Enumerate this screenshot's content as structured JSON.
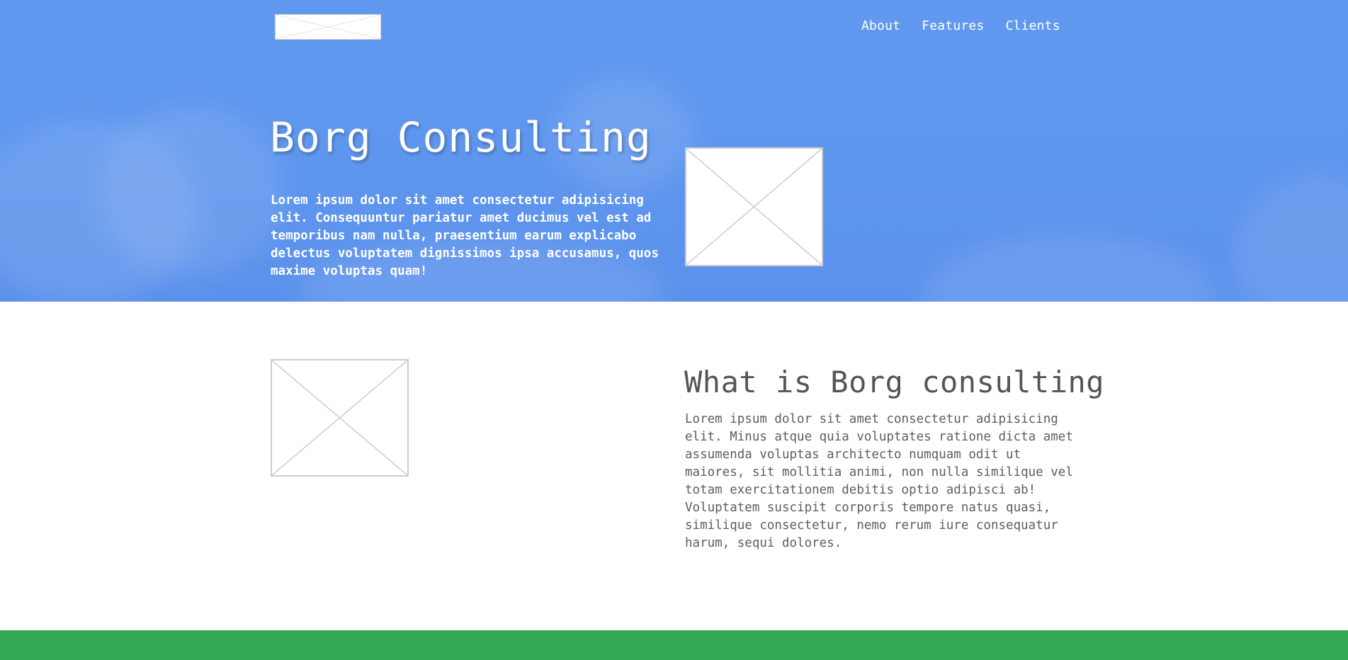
{
  "header": {
    "logo_icon": "image-placeholder-icon",
    "nav": [
      "About",
      "Features",
      "Clients"
    ]
  },
  "hero": {
    "title": "Borg Consulting",
    "text": "Lorem ipsum dolor sit amet consectetur adipisicing elit. Consequuntur pariatur amet ducimus vel est ad temporibus nam nulla, praesentium earum explicabo delectus voluptatem dignissimos ipsa accusamus, quos maxime voluptas quam!",
    "image_icon": "image-placeholder-icon"
  },
  "about": {
    "title": "What is Borg consulting",
    "text": "Lorem ipsum dolor sit amet consectetur adipisicing elit. Minus atque quia voluptates ratione dicta amet assumenda voluptas architecto numquam odit ut maiores, sit mollitia animi, non nulla similique vel totam exercitationem debitis optio adipisci ab! Voluptatem suscipit corporis tempore natus quasi, similique consectetur, nemo rerum iure consequatur harum, sequi dolores.",
    "image_icon": "image-placeholder-icon"
  },
  "colors": {
    "hero_blue": "#5f97ef",
    "footer_green": "#34a853",
    "heading_gray": "#555555",
    "text_gray": "#5e5e5e"
  }
}
